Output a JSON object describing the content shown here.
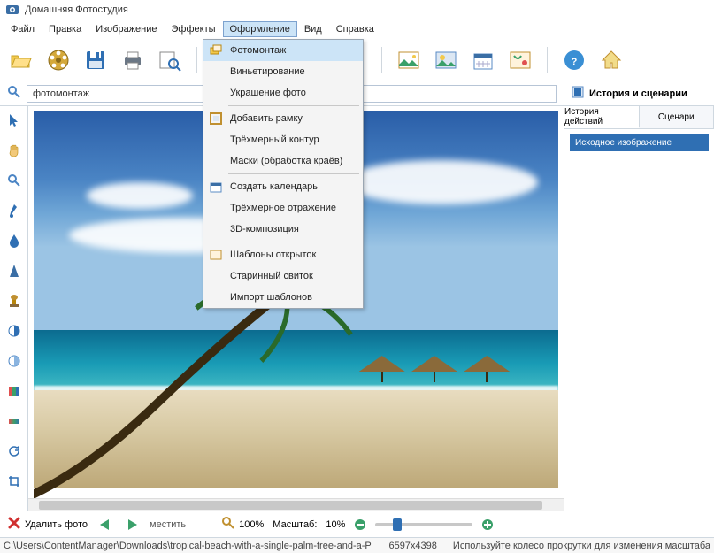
{
  "window": {
    "title": "Домашняя Фотостудия"
  },
  "menu": {
    "file": "Файл",
    "edit": "Правка",
    "image": "Изображение",
    "effects": "Эффекты",
    "design": "Оформление",
    "view": "Вид",
    "help": "Справка"
  },
  "dropdown": {
    "photomontage": "Фотомонтаж",
    "vignetting": "Виньетирование",
    "decorate": "Украшение фото",
    "add_frame": "Добавить рамку",
    "contour3d": "Трёхмерный контур",
    "masks": "Маски (обработка краёв)",
    "calendar": "Создать календарь",
    "reflection3d": "Трёхмерное отражение",
    "compose3d": "3D-композиция",
    "postcards": "Шаблоны открыток",
    "scroll_old": "Старинный свиток",
    "import_tpl": "Импорт шаблонов"
  },
  "search": {
    "value": "фотомонтаж"
  },
  "right": {
    "title": "История и сценарии",
    "tab_history": "История действий",
    "tab_scenarios": "Сценари",
    "item_source": "Исходное изображение"
  },
  "bottom": {
    "delete": "Удалить фото",
    "move": "местить",
    "zoom_magnifier": "100%",
    "scale_label": "Масштаб:",
    "scale_value": "10%"
  },
  "status": {
    "path": "C:\\Users\\ContentManager\\Downloads\\tropical-beach-with-a-single-palm-tree-and-a-PR\\",
    "dims": "6597x4398",
    "hint": "Используйте колесо прокрутки для изменения масштаба"
  }
}
